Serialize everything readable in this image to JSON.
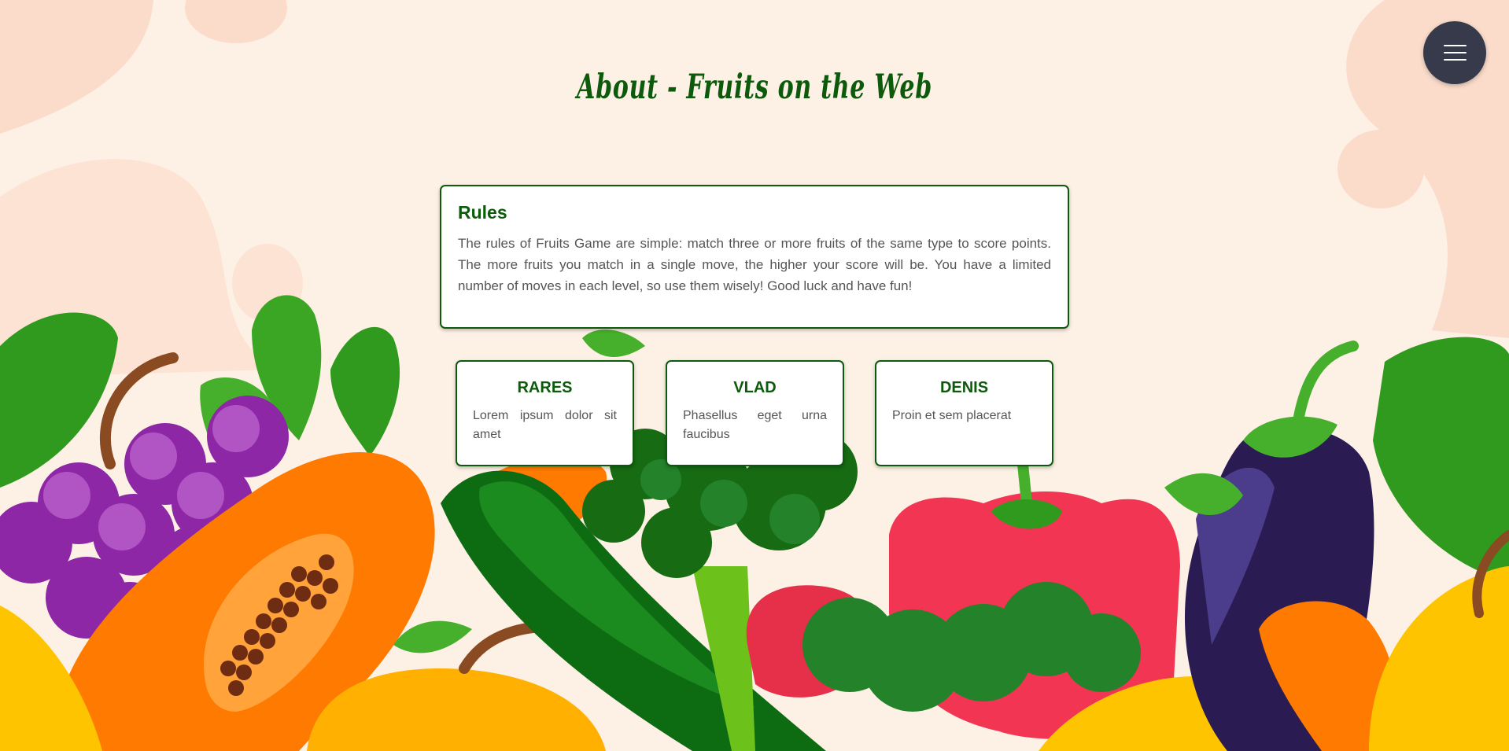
{
  "page": {
    "title": "About - Fruits on the Web"
  },
  "menu": {
    "icon": "hamburger-icon"
  },
  "rules": {
    "heading": "Rules",
    "text": "The rules of Fruits Game are simple: match three or more fruits of the same type to score points. The more fruits you match in a single move, the higher your score will be. You have a limited number of moves in each level, so use them wisely! Good luck and have fun!"
  },
  "team": [
    {
      "name": "RARES",
      "text": "Lorem ipsum dolor sit amet"
    },
    {
      "name": "VLAD",
      "text": "Phasellus eget urna faucibus"
    },
    {
      "name": "DENIS",
      "text": "Proin et sem placerat"
    }
  ],
  "colors": {
    "background": "#fdf0e4",
    "accent": "#0d5a0d",
    "menu_button": "#363a4b"
  }
}
